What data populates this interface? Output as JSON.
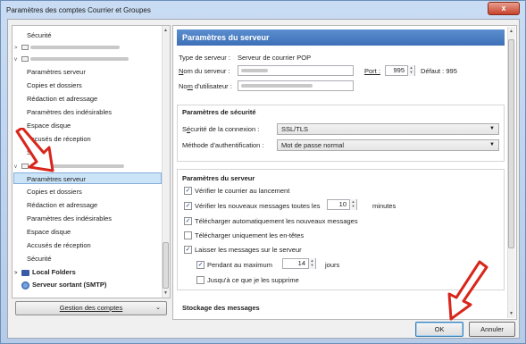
{
  "window": {
    "title": "Paramètres des comptes Courrier et Groupes",
    "close_glyph": "x"
  },
  "tree": {
    "items": [
      {
        "label": "Sécurité"
      },
      {
        "label": "Paramètres serveur"
      },
      {
        "label": "Copies et dossiers"
      },
      {
        "label": "Rédaction et adressage"
      },
      {
        "label": "Paramètres des indésirables"
      },
      {
        "label": "Espace disque"
      },
      {
        "label": "Accusés de réception"
      },
      {
        "label": "Sécurité"
      },
      {
        "label": "Paramètres serveur"
      },
      {
        "label": "Copies et dossiers"
      },
      {
        "label": "Rédaction et adressage"
      },
      {
        "label": "Paramètres des indésirables"
      },
      {
        "label": "Espace disque"
      },
      {
        "label": "Accusés de réception"
      },
      {
        "label": "Sécurité"
      },
      {
        "label": "Local Folders"
      },
      {
        "label": "Serveur sortant (SMTP)"
      }
    ]
  },
  "gestion_button": "Gestion des comptes",
  "panel": {
    "header": "Paramètres du serveur",
    "server_type_label": "Type de serveur :",
    "server_type_value": "Serveur de courrier POP",
    "server_name_label_u": "N",
    "server_name_label_rest": "om du serveur :",
    "port_label": "Port :",
    "port_value": "995",
    "default_label": "Défaut : 995",
    "user_label_pre": "No",
    "user_label_u": "m",
    "user_label_post": " d'utilisateur :",
    "security_title": "Paramètres de sécurité",
    "conn_security_label_pre": "S",
    "conn_security_label_u": "é",
    "conn_security_label_post": "curité de la connexion :",
    "conn_security_value": "SSL/TLS",
    "auth_label": "Méthode d'authentification :",
    "auth_value": "Mot de passe normal",
    "server_title": "Paramètres du serveur",
    "check_startup": "Vérifier le courrier au lancement",
    "check_every": "Vérifier les nouveaux messages toutes les",
    "check_every_value": "10",
    "minutes": "minutes",
    "auto_download": "Télécharger automatiquement les nouveaux messages",
    "headers_only": "Télécharger uniquement les en-têtes",
    "leave_on_server": "Laisser les messages sur le serveur",
    "max_days_label": "Pendant au maximum",
    "max_days_value": "14",
    "days": "jours",
    "until_delete": "Jusqu'à ce que je les supprime",
    "storage_title": "Stockage des messages"
  },
  "buttons": {
    "ok": "OK",
    "cancel": "Annuler"
  },
  "checkmark": "✓",
  "colors": {
    "header_blue": "#3d6fb7",
    "arrow_red": "#d9261c"
  }
}
